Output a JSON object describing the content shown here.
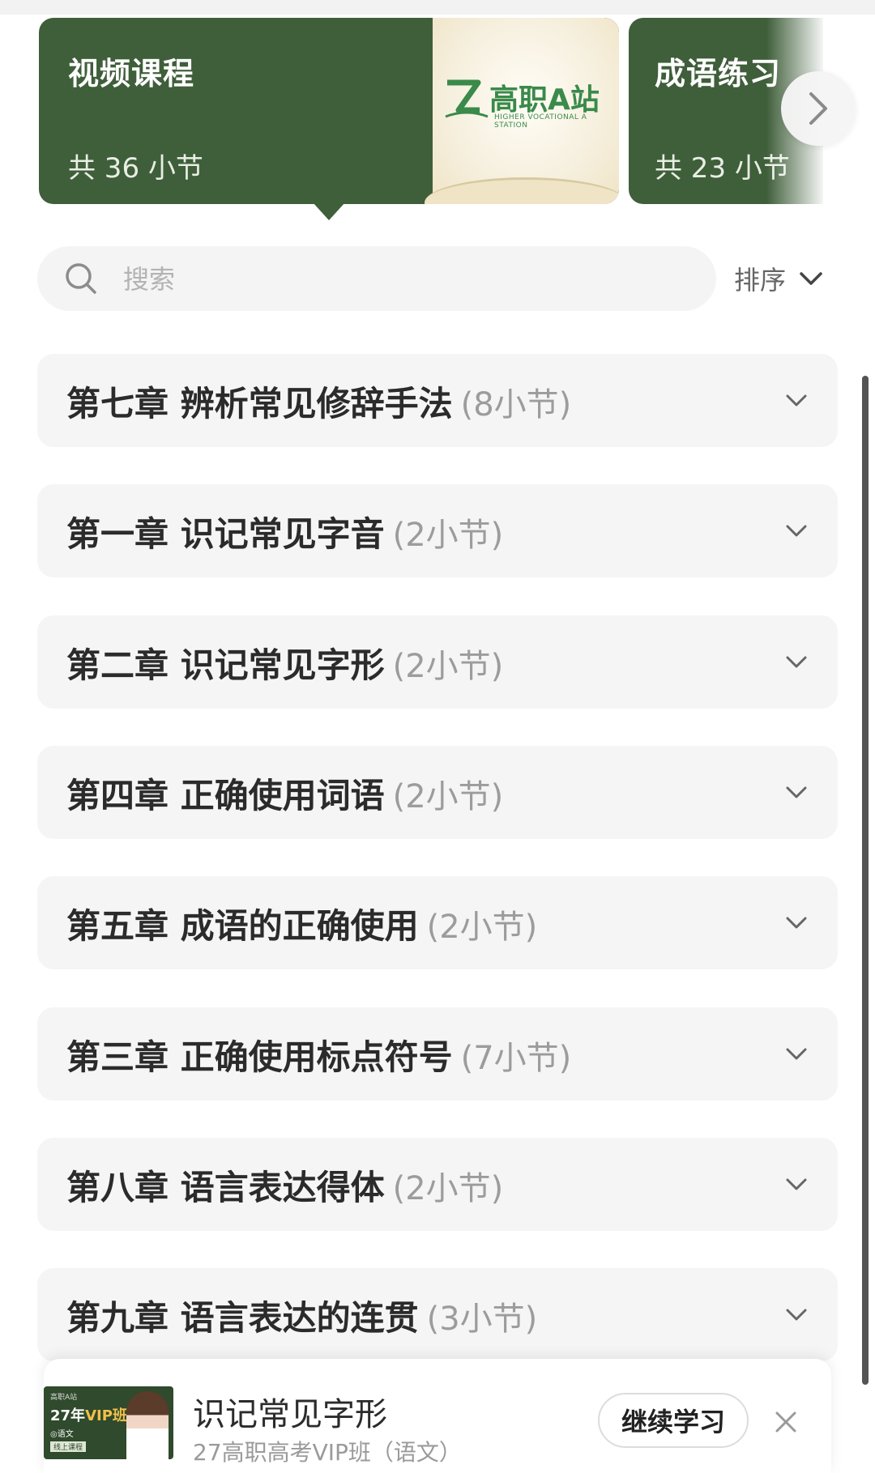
{
  "cards": [
    {
      "title": "视频课程",
      "count": "共 36 小节",
      "logo_text": "高职A站",
      "logo_subtitle": "HIGHER VOCATIONAL A STATION"
    },
    {
      "title": "成语练习",
      "count": "共 23 小节"
    }
  ],
  "search": {
    "placeholder": "搜索"
  },
  "sort": {
    "label": "排序"
  },
  "chapters": [
    {
      "title": "第七章  辨析常见修辞手法",
      "count": "(8小节)"
    },
    {
      "title": "第一章  识记常见字音",
      "count": "(2小节)"
    },
    {
      "title": "第二章  识记常见字形",
      "count": "(2小节)"
    },
    {
      "title": "第四章  正确使用词语",
      "count": "(2小节)"
    },
    {
      "title": "第五章  成语的正确使用",
      "count": "(2小节)"
    },
    {
      "title": "第三章  正确使用标点符号",
      "count": "(7小节)"
    },
    {
      "title": "第八章  语言表达得体",
      "count": "(2小节)"
    },
    {
      "title": "第九章  语言表达的连贯",
      "count": "(3小节)"
    }
  ],
  "mini_player": {
    "cover_brand": "高职A站",
    "cover_year": "27年",
    "cover_vip": "VIP班",
    "cover_subject": "◎语文",
    "cover_tag": "线上课程",
    "title": "识记常见字形",
    "subtitle": "27高职高考VIP班（语文）",
    "continue_label": "继续学习"
  },
  "colors": {
    "card_green": "#3f5e3a",
    "logo_green": "#3a8a4a",
    "chapter_bg": "#f5f5f5"
  }
}
